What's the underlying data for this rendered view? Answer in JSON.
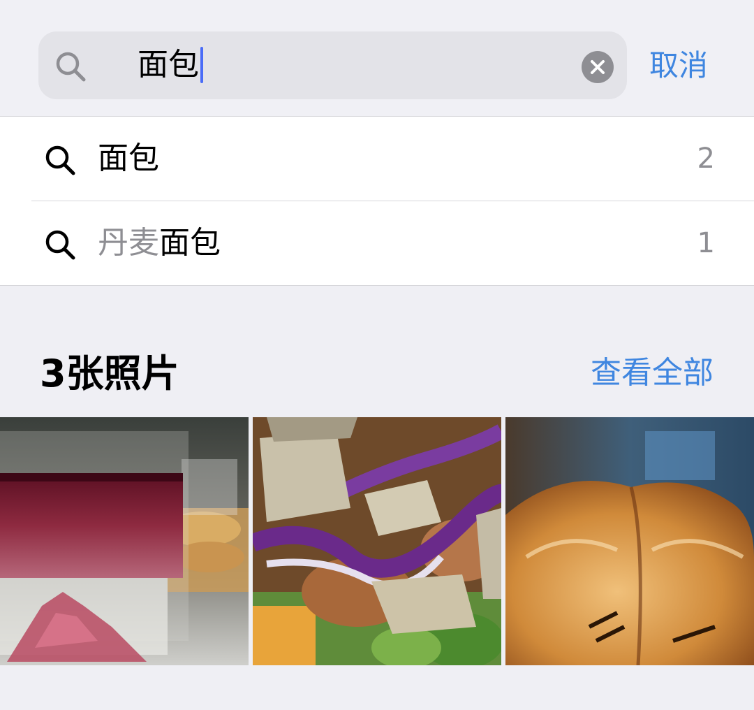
{
  "search": {
    "query": "面包",
    "cancel_label": "取消"
  },
  "suggestions": [
    {
      "prefix": "",
      "match": "面包",
      "count": "2"
    },
    {
      "prefix": "丹麦",
      "match": "面包",
      "count": "1"
    }
  ],
  "results": {
    "title": "3张照片",
    "see_all_label": "查看全部"
  },
  "photos": [
    {
      "subject": "sparkling red drink in glass with snacks"
    },
    {
      "subject": "salad with croutons, red cabbage and chicken"
    },
    {
      "subject": "baked bread pastry"
    }
  ],
  "colors": {
    "accent": "#3f86e0",
    "caret": "#4a6cf7",
    "muted_text": "#8e8e93"
  }
}
